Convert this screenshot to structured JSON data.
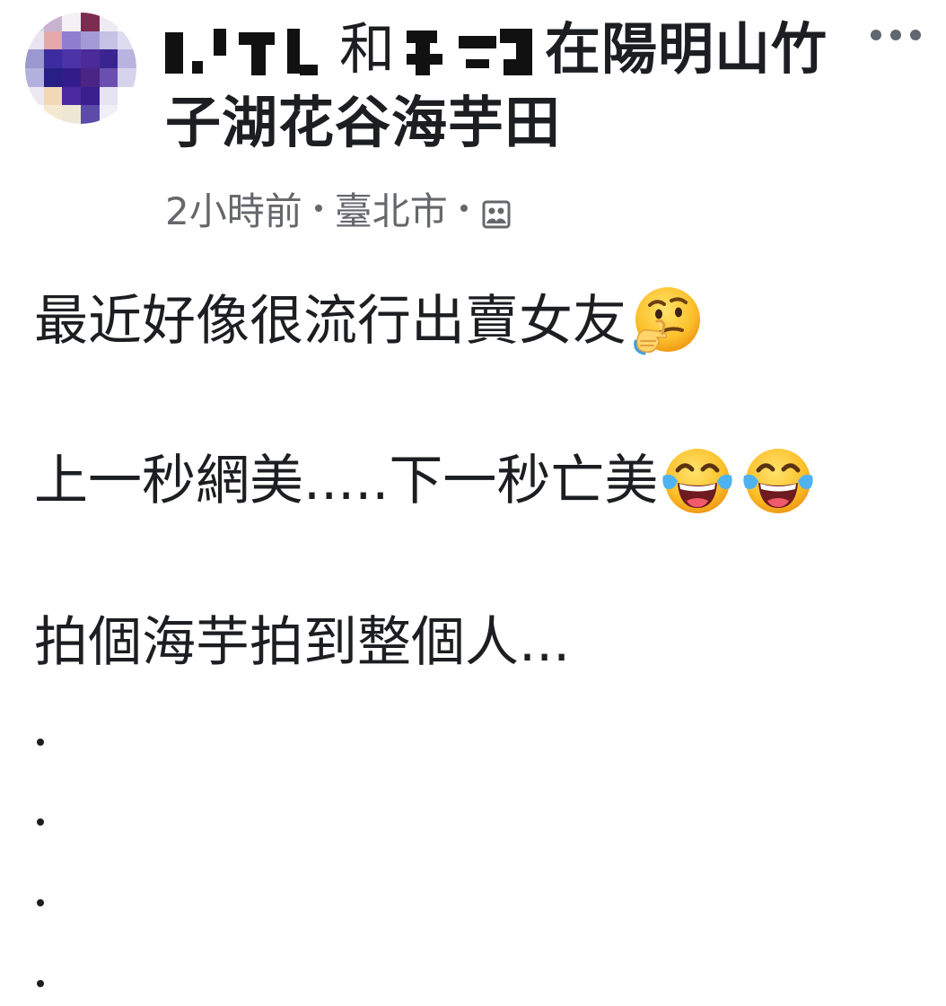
{
  "post": {
    "title_connector": "和",
    "title_location": "在陽明山竹",
    "title_location_line2": "子湖花谷海芋田",
    "time": "2小時前",
    "place": "臺北市",
    "privacy_icon": "photo-album-icon",
    "more_icon": "more-options-icon",
    "avatar_colors": [
      "#d7dce8",
      "#c9b2d0",
      "#f3f0f6",
      "#7c2c4f",
      "#eeeaf4",
      "#ffffff",
      "#e9e4f1",
      "#e5a9a9",
      "#8f7fce",
      "#a49bd6",
      "#c5c2e6",
      "#dcdcee",
      "#9b97cf",
      "#3b2c9f",
      "#4d33a8",
      "#4b2b97",
      "#3a2492",
      "#b8b4df",
      "#b4b0dd",
      "#281f86",
      "#331c89",
      "#4a2585",
      "#6b4fb0",
      "#d6d3ec",
      "#ece7f0",
      "#f2d8b6",
      "#4b2aa1",
      "#3c1f8f",
      "#e7e3f2",
      "#ffffff",
      "#ffffff",
      "#f5e9d2",
      "#efe7d6",
      "#5d4ba8",
      "#f0eef6",
      "#ffffff"
    ]
  },
  "content": {
    "line1": "最近好像很流行出賣女友",
    "line1_emoji": "thinking-face-emoji",
    "line2": "上一秒網美.....下一秒亡美",
    "line2_emoji": "tears-of-joy-emoji",
    "line3": "拍個海芋拍到整個人..."
  }
}
